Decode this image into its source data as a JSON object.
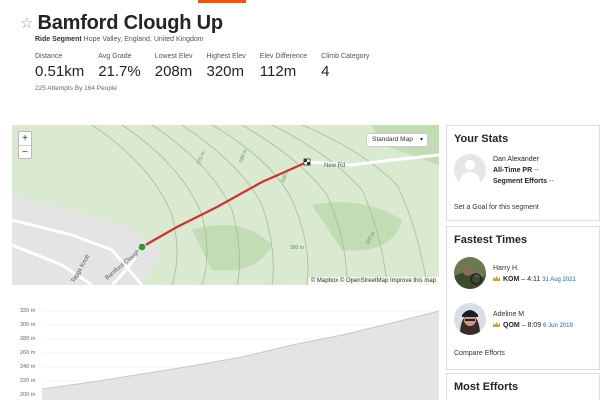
{
  "segment": {
    "title": "Bamford Clough Up",
    "type_label": "Ride Segment",
    "location": "Hope Valley, England, United Kingdom",
    "attempts": "225 Attempts By 164 People"
  },
  "stats": [
    {
      "label": "Distance",
      "value": "0.51km"
    },
    {
      "label": "Avg Grade",
      "value": "21.7%"
    },
    {
      "label": "Lowest Elev",
      "value": "208m"
    },
    {
      "label": "Highest Elev",
      "value": "320m"
    },
    {
      "label": "Elev Difference",
      "value": "112m"
    },
    {
      "label": "Climb Category",
      "value": "4"
    }
  ],
  "map": {
    "zoom_in": "+",
    "zoom_out": "−",
    "map_type": "Standard Map",
    "attribution": "© Mapbox © OpenStreetMap Improve this map",
    "labels": {
      "new_rd": "New Rd",
      "bamford_clough": "Bamford Clough",
      "taggs_knoll": "Taggs Knoll",
      "c270": "270 m",
      "c280": "280 m",
      "c290": "290 m",
      "c300": "300 m",
      "c320": "320 m"
    }
  },
  "elevation_chart": {
    "ticks": [
      "320 m",
      "300 m",
      "280 m",
      "260 m",
      "240 m",
      "220 m",
      "200 m"
    ]
  },
  "your_stats": {
    "title": "Your Stats",
    "name": "Dan Alexander",
    "pr_label": "All-Time PR",
    "pr_value": "--",
    "efforts_label": "Segment Efforts",
    "efforts_value": "--",
    "goal_link": "Set a Goal for this segment"
  },
  "fastest_times": {
    "title": "Fastest Times",
    "entries": [
      {
        "name": "Harry H.",
        "badge": "KOM",
        "time": "4:11",
        "date": "31 Aug 2021"
      },
      {
        "name": "Adeline M",
        "badge": "QOM",
        "time": "8:09",
        "date": "6 Jun 2019"
      }
    ],
    "compare_link": "Compare Efforts"
  },
  "most_efforts": {
    "title": "Most Efforts"
  },
  "colors": {
    "accent": "#fc5200",
    "route": "#d32f2f",
    "start_marker": "#2e9e2e",
    "map_bg": "#d9ead0",
    "date_link": "#0a6ebd"
  }
}
